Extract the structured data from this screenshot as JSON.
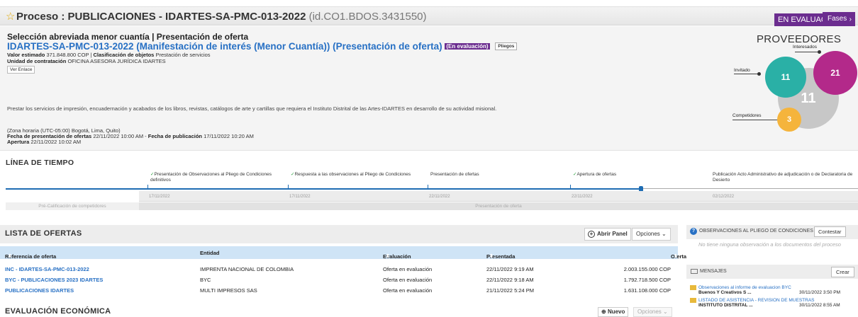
{
  "header": {
    "title": "Proceso : PUBLICACIONES - IDARTES-SA-PMC-013-2022",
    "id": "(id.CO1.BDOS.3431550)",
    "status_badge": "EN EVALUACIÓN",
    "fases_label": "Fases"
  },
  "summary": {
    "modality": "Selección abreviada menor cuantía | Presentación de oferta",
    "title": "IDARTES-SA-PMC-013-2022 (Manifestación de interés (Menor Cuantía)) (Presentación de oferta)",
    "status_pill": "(En evaluación)",
    "pliegos": "Pliegos",
    "valor_label": "Valor estimado",
    "valor": "371.848.800 COP | ",
    "clasificacion_label": "Clasificación de objetos",
    "clasificacion": "Prestación de servicios",
    "unidad_label": "Unidad de contratación",
    "unidad": "OFICINA ASESORA JURÍDICA IDARTES",
    "ver_enlace": "Ver Enlace",
    "description": "Prestar los servicios de impresión, encuadernación y acabados de los libros, revistas, catálogos de arte y cartillas que requiera el Instituto Distrital de las Artes-IDARTES en desarrollo de su actividad misional.",
    "timezone": "(Zona horaria (UTC-05:00) Bogotá, Lima, Quito)",
    "fecha_presentacion_label": "Fecha de presentación de ofertas",
    "fecha_presentacion": "22/11/2022 10:00 AM - ",
    "fecha_publicacion_label": "Fecha de publicación",
    "fecha_publicacion": "17/11/2022 10:20 AM",
    "apertura_label": "Apertura",
    "apertura": "22/11/2022 10:02 AM"
  },
  "proveedores": {
    "title": "PROVEEDORES",
    "interesados_label": "Interesados",
    "invitado_label": "Invitado",
    "competidores_label": "Competidores",
    "invitado_count": "11",
    "interesados_count": "21",
    "big_count": "11",
    "competidores_count": "3",
    "colors": {
      "teal": "#2ab0a6",
      "magenta": "#b3298a",
      "gray": "#c7c7c7",
      "orange": "#f5b43c"
    }
  },
  "timeline": {
    "title": "LÍNEA DE TIEMPO",
    "steps": [
      {
        "label": "Presentación de Observaciones al Pliego de Condiciones definitivos",
        "date": "17/11/2022",
        "done": true
      },
      {
        "label": "Respuesta a las observaciones al Pliego de Condiciones",
        "date": "17/11/2022",
        "done": true
      },
      {
        "label": "Presentación de ofertas",
        "date": "22/11/2022",
        "done": false
      },
      {
        "label": "Apertura de ofertas",
        "date": "22/11/2022",
        "done": true
      },
      {
        "label": "Publicación Acto Administrativo de adjudicación o de Declaratoria de Desierto",
        "date": "02/12/2022",
        "done": false
      }
    ],
    "band_left": "Pré-Calificación de competidores",
    "band_right": "Presentación de oferta"
  },
  "ofertas": {
    "title": "LISTA DE OFERTAS",
    "abrir_panel": "Abrir Panel",
    "opciones": "Opciones",
    "columns": [
      "Referencia de oferta",
      "Entidad",
      "Evaluación",
      "Presentada",
      "Oferta"
    ],
    "rows": [
      {
        "ref": "INC - IDARTES-SA-PMC-013-2022",
        "entidad": "IMPRENTA NACIONAL DE COLOMBIA",
        "evaluacion": "Oferta en evaluación",
        "presentada": "22/11/2022 9:19 AM",
        "oferta": "2.003.155.000 COP"
      },
      {
        "ref": "BYC - PUBLICACIONES 2023 IDARTES",
        "entidad": "BYC",
        "evaluacion": "Oferta en evaluación",
        "presentada": "22/11/2022 9:18 AM",
        "oferta": "1.792.718.500 COP"
      },
      {
        "ref": "PUBLICACIONES IDARTES",
        "entidad": "MULTI IMPRESOS SAS",
        "evaluacion": "Oferta en evaluación",
        "presentada": "21/11/2022 5:24 PM",
        "oferta": "1.631.108.000 COP"
      }
    ]
  },
  "evaluacion": {
    "title": "EVALUACIÓN ECONÓMICA",
    "nuevo": "Nuevo",
    "opciones": "Opciones"
  },
  "observaciones": {
    "title": "OBSERVACIONES AL PLIEGO DE CONDICIONES",
    "contestar": "Contestar",
    "empty": "No tiene ninguna observación a los documentos del proceso"
  },
  "mensajes": {
    "title": "MENSAJES",
    "crear": "Crear",
    "items": [
      {
        "subject": "Observaciones al informe de evaluacion BYC",
        "from": "Buenos Y Creativos S ...",
        "date": "30/11/2022 3:50 PM"
      },
      {
        "subject": "LISTADO DE ASISTENCIA - REVISION DE MUESTRAS",
        "from": "INSTITUTO DISTRITAL ...",
        "date": "30/11/2022 8:55 AM"
      }
    ]
  }
}
